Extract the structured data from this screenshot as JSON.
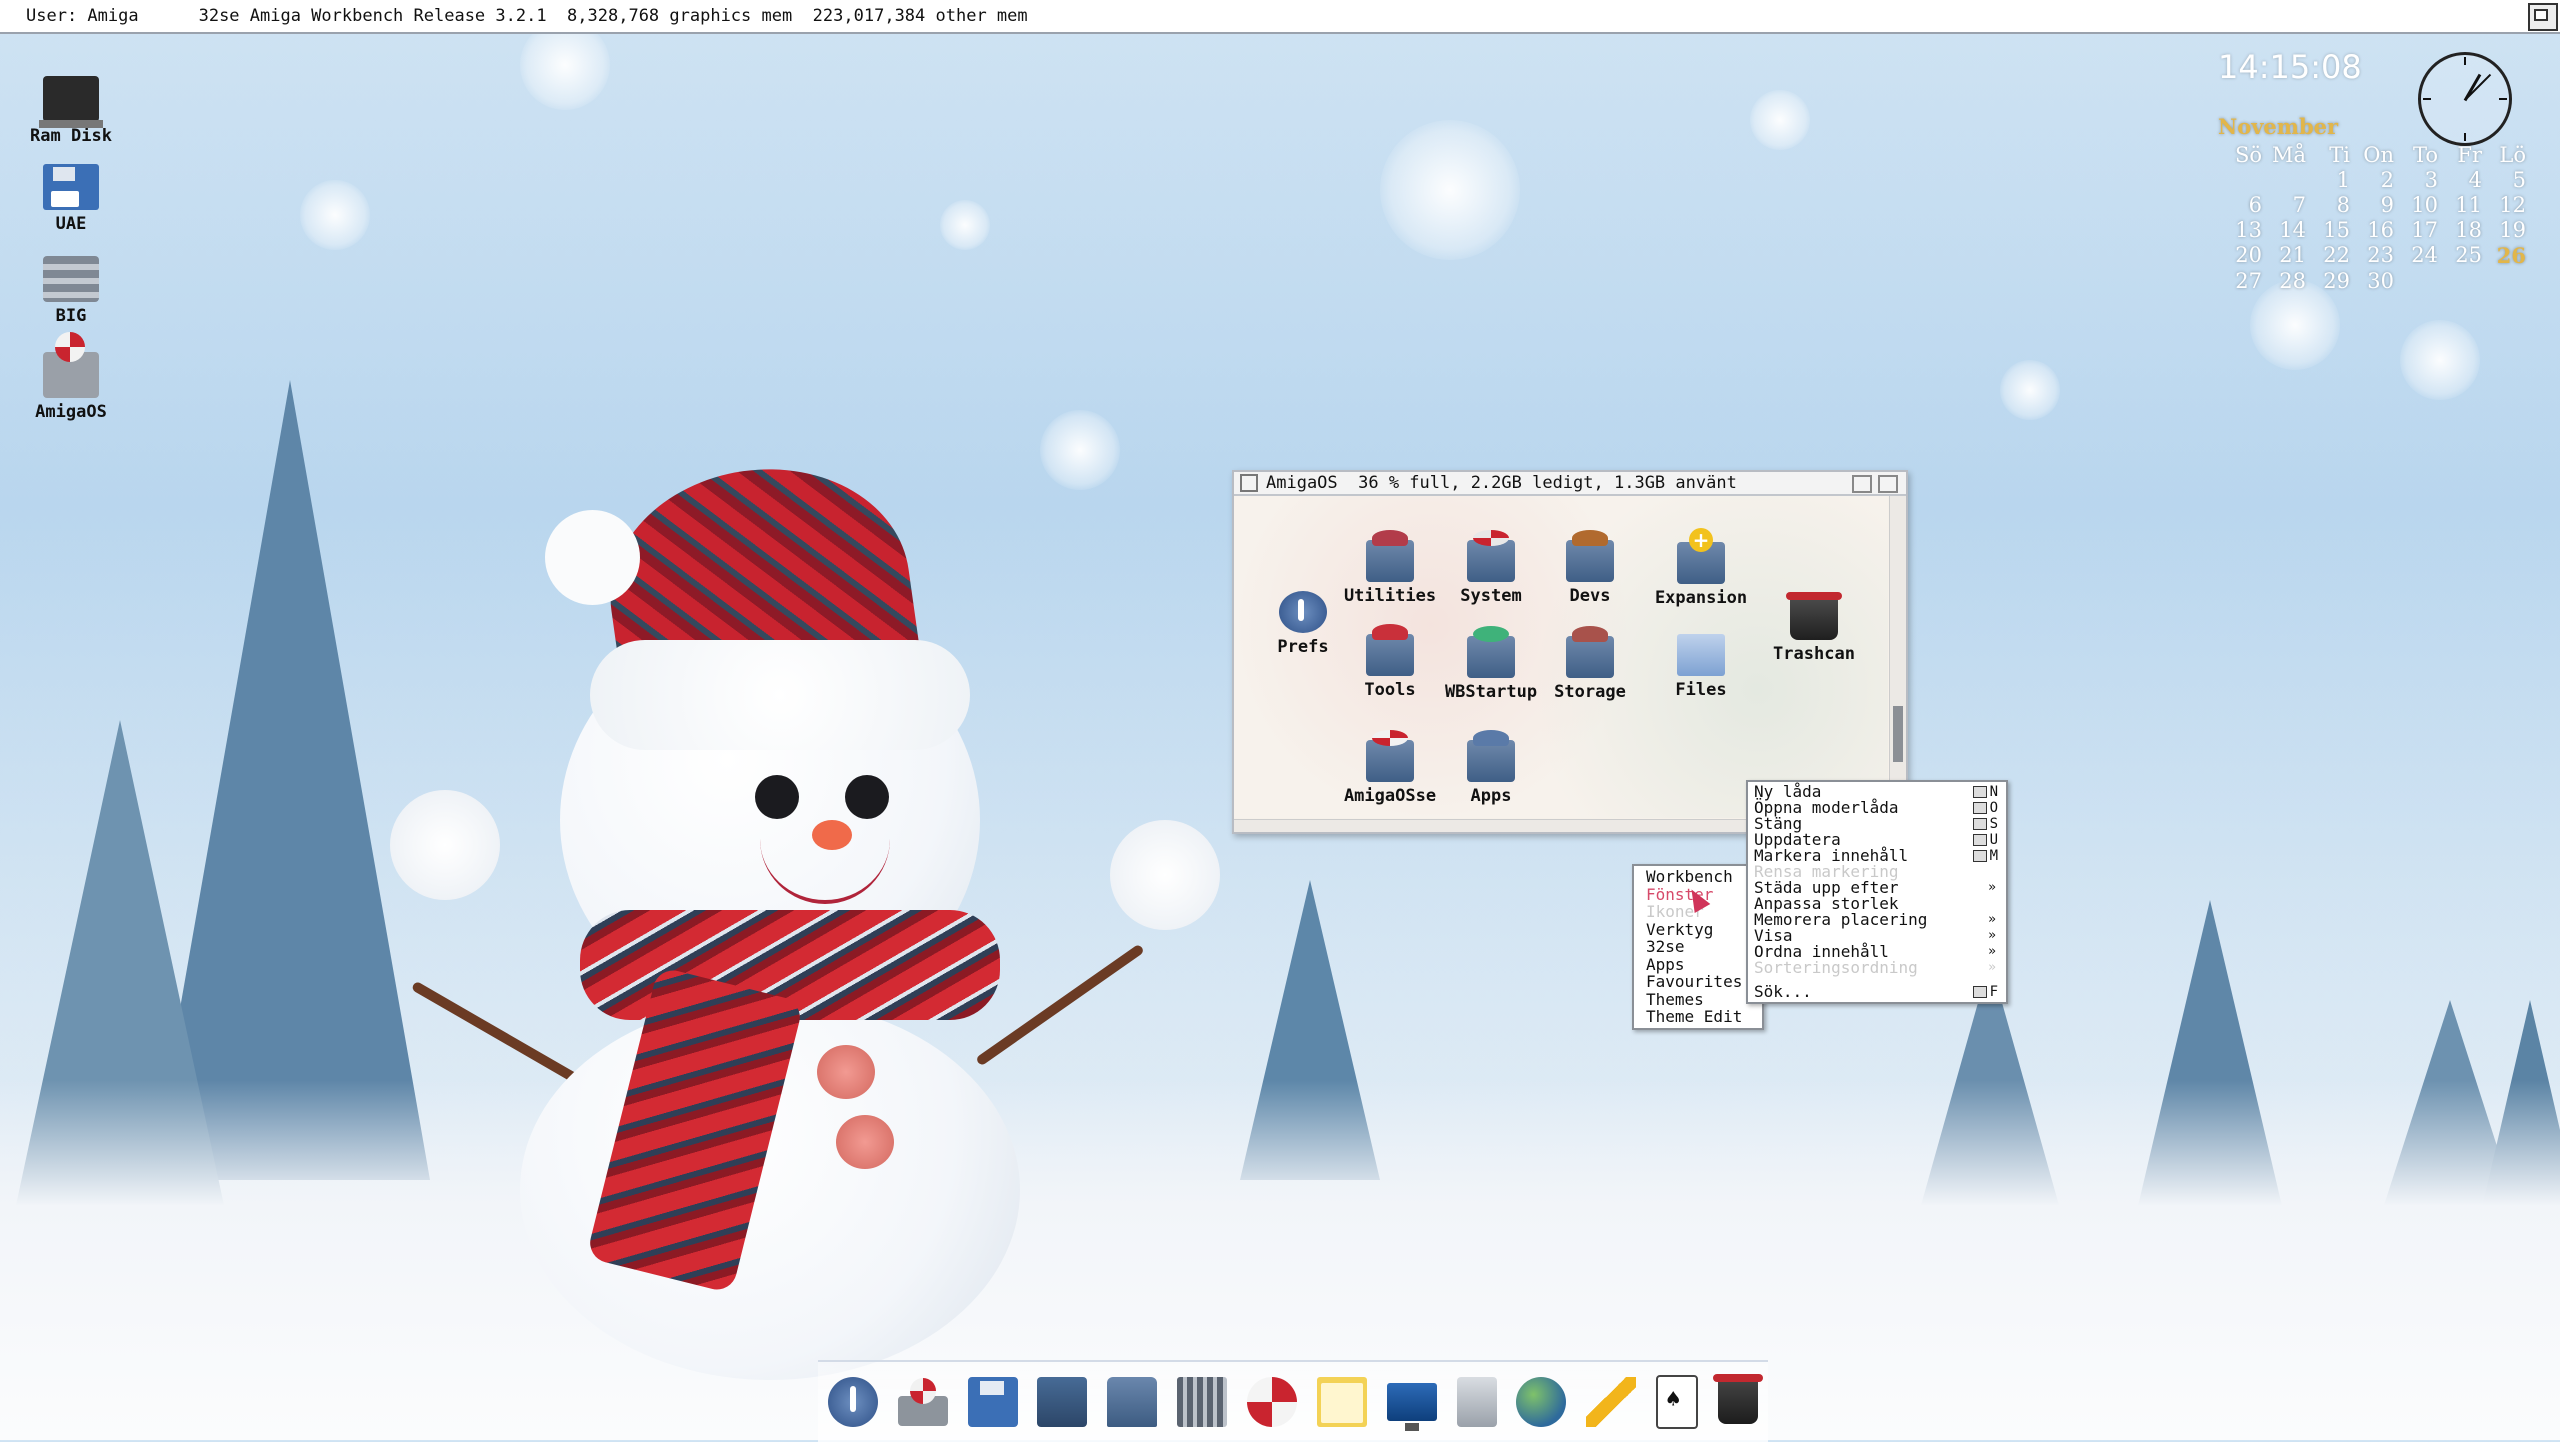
{
  "screen_bar": {
    "user": "User: Amiga",
    "title": "32se Amiga Workbench Release 3.2.1  8,328,768 graphics mem  223,017,384 other mem"
  },
  "desktop_icons": [
    {
      "label": "Ram Disk",
      "icon": "ram-disk-icon"
    },
    {
      "label": "UAE",
      "icon": "floppy-disk-icon"
    },
    {
      "label": "BIG",
      "icon": "hard-drive-icon"
    },
    {
      "label": "AmigaOS",
      "icon": "amiga-ball-drive-icon"
    }
  ],
  "clock": {
    "time": "14:15:08"
  },
  "calendar": {
    "month": "November",
    "weekdays": [
      "Sö",
      "Må",
      "Ti",
      "On",
      "To",
      "Fr",
      "Lö"
    ],
    "days": [
      "",
      "",
      "1",
      "2",
      "3",
      "4",
      "5",
      "6",
      "7",
      "8",
      "9",
      "10",
      "11",
      "12",
      "13",
      "14",
      "15",
      "16",
      "17",
      "18",
      "19",
      "20",
      "21",
      "22",
      "23",
      "24",
      "25",
      "26",
      "27",
      "28",
      "29",
      "30",
      "",
      "",
      ""
    ],
    "today": "26",
    "today_color": "#e2b64a"
  },
  "window": {
    "title": "AmigaOS  36 % full, 2.2GB ledigt, 1.3GB använt",
    "icons": [
      {
        "label": "Prefs",
        "icon": "prefs-icon"
      },
      {
        "label": "Utilities",
        "icon": "utilities-drawer-icon"
      },
      {
        "label": "System",
        "icon": "system-drawer-icon"
      },
      {
        "label": "Devs",
        "icon": "devs-drawer-icon"
      },
      {
        "label": "Expansion",
        "icon": "expansion-drawer-icon"
      },
      {
        "label": "Trashcan",
        "icon": "trashcan-icon"
      },
      {
        "label": "Tools",
        "icon": "tools-drawer-icon"
      },
      {
        "label": "WBStartup",
        "icon": "wbstartup-drawer-icon"
      },
      {
        "label": "Storage",
        "icon": "storage-drawer-icon"
      },
      {
        "label": "Files",
        "icon": "files-drawer-icon"
      },
      {
        "label": "AmigaOSse",
        "icon": "amigaosse-drawer-icon"
      },
      {
        "label": "Apps",
        "icon": "apps-drawer-icon"
      }
    ]
  },
  "main_menu": {
    "items": [
      {
        "label": "Workbench",
        "state": "normal"
      },
      {
        "label": "Fönster",
        "state": "selected"
      },
      {
        "label": "Ikoner",
        "state": "disabled"
      },
      {
        "label": "Verktyg",
        "state": "normal"
      },
      {
        "label": "32se",
        "state": "normal"
      },
      {
        "label": "Apps",
        "state": "normal"
      },
      {
        "label": "Favourites",
        "state": "normal"
      },
      {
        "label": "Themes",
        "state": "normal"
      },
      {
        "label": "Theme Edit",
        "state": "normal"
      }
    ],
    "selected_color": "#d64a6a"
  },
  "submenu": {
    "items": [
      {
        "label": "Ny låda",
        "shortcut": "N",
        "state": "normal"
      },
      {
        "label": "Öppna moderlåda",
        "shortcut": "O",
        "state": "normal"
      },
      {
        "label": "Stäng",
        "shortcut": "S",
        "state": "normal"
      },
      {
        "label": "Uppdatera",
        "shortcut": "U",
        "state": "normal"
      },
      {
        "label": "Markera innehåll",
        "shortcut": "M",
        "state": "normal"
      },
      {
        "label": "Rensa markering",
        "shortcut": "",
        "state": "disabled"
      },
      {
        "label": "Städa upp efter",
        "shortcut": "",
        "state": "normal",
        "submenu": true
      },
      {
        "label": "Anpassa storlek",
        "shortcut": "",
        "state": "normal"
      },
      {
        "label": "Memorera placering",
        "shortcut": "",
        "state": "normal",
        "submenu": true
      },
      {
        "label": "Visa",
        "shortcut": "",
        "state": "normal",
        "submenu": true
      },
      {
        "label": "Ordna innehåll",
        "shortcut": "",
        "state": "normal",
        "submenu": true
      },
      {
        "label": "Sorteringsordning",
        "shortcut": "",
        "state": "disabled",
        "submenu": true
      },
      {
        "label": "Sök...",
        "shortcut": "F",
        "state": "normal"
      }
    ]
  },
  "dock": [
    {
      "icon": "prefs-icon"
    },
    {
      "icon": "system-icon"
    },
    {
      "icon": "floppy-disk-icon"
    },
    {
      "icon": "notes-icon"
    },
    {
      "icon": "printer-icon"
    },
    {
      "icon": "keyboard-icon"
    },
    {
      "icon": "amiga-ball-icon"
    },
    {
      "icon": "folder-icon"
    },
    {
      "icon": "monitor-icon"
    },
    {
      "icon": "calculator-icon"
    },
    {
      "icon": "globe-icon"
    },
    {
      "icon": "pencil-icon"
    },
    {
      "icon": "cards-icon"
    },
    {
      "icon": "trashcan-icon"
    }
  ]
}
